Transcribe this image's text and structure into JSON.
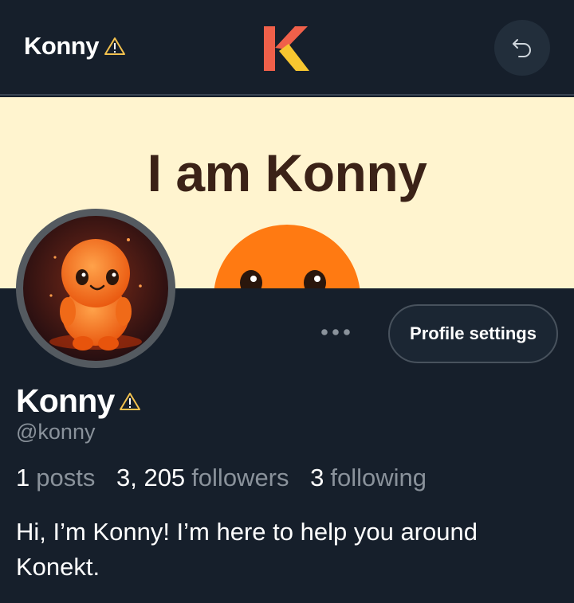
{
  "header": {
    "title": "Konny",
    "warning_icon": "warning-triangle-icon",
    "logo_icon": "konekt-k-logo",
    "back_icon": "undo-arrow-icon"
  },
  "banner": {
    "text": "I am Konny"
  },
  "profile": {
    "avatar_icon": "konny-mascot-avatar",
    "more_icon": "more-dots-icon",
    "settings_label": "Profile settings",
    "name": "Konny",
    "handle": "@konny",
    "stats": [
      {
        "value": "1",
        "label": "posts"
      },
      {
        "value": "3, 205",
        "label": "followers"
      },
      {
        "value": "3",
        "label": "following"
      }
    ],
    "bio": "Hi, I’m Konny! I’m here to help you around Konekt."
  },
  "colors": {
    "background": "#161f2b",
    "banner_bg": "#fff4cf",
    "banner_text": "#3b2217",
    "muted_text": "#8a929b",
    "warning": "#f2c14e",
    "logo_red": "#f0604a",
    "logo_yellow": "#f7c630",
    "mascot_orange": "#ff7a12"
  }
}
